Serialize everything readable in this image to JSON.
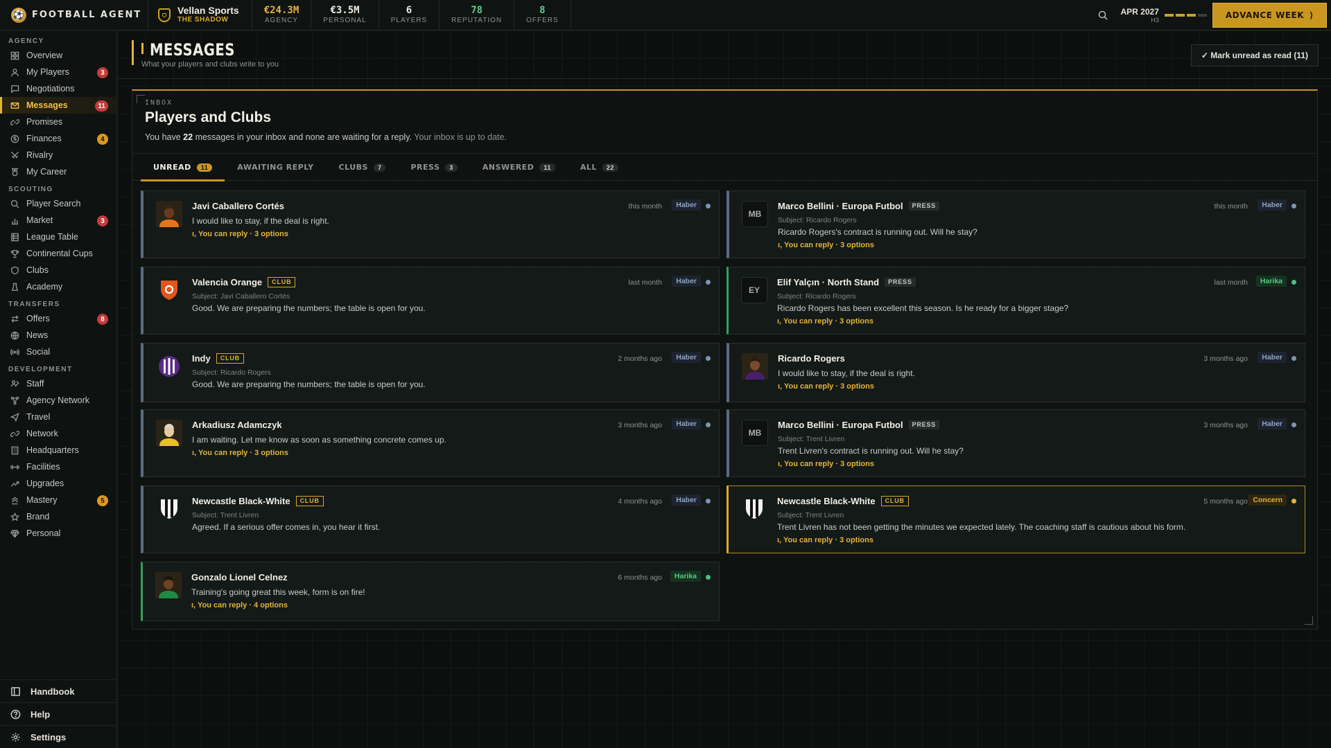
{
  "app": {
    "name": "FOOTBALL AGENT"
  },
  "agency": {
    "name": "Vellan Sports",
    "tagline": "THE SHADOW"
  },
  "stats": [
    {
      "value": "€24.3M",
      "label": "AGENCY"
    },
    {
      "value": "€3.5M",
      "label": "PERSONAL"
    },
    {
      "value": "6",
      "label": "PLAYERS"
    },
    {
      "value": "78",
      "label": "REPUTATION"
    },
    {
      "value": "8",
      "label": "OFFERS"
    }
  ],
  "topbar": {
    "date": "APR 2027",
    "week": "H3",
    "week_progress": 0.75,
    "advance_label": "ADVANCE WEEK"
  },
  "sidebar": {
    "sections": [
      {
        "title": "AGENCY",
        "items": [
          {
            "label": "Overview",
            "icon": "grid-icon"
          },
          {
            "label": "My Players",
            "icon": "user-icon",
            "badge": "3",
            "badge_color": "red"
          },
          {
            "label": "Negotiations",
            "icon": "chat-icon"
          },
          {
            "label": "Messages",
            "icon": "mail-icon",
            "badge": "11",
            "badge_color": "red",
            "active": true
          },
          {
            "label": "Promises",
            "icon": "link-icon"
          },
          {
            "label": "Finances",
            "icon": "coin-icon",
            "badge": "4",
            "badge_color": "amber"
          },
          {
            "label": "Rivalry",
            "icon": "swords-icon"
          },
          {
            "label": "My Career",
            "icon": "medal-icon"
          }
        ]
      },
      {
        "title": "SCOUTING",
        "items": [
          {
            "label": "Player Search",
            "icon": "search-icon"
          },
          {
            "label": "Market",
            "icon": "bars-icon",
            "badge": "3",
            "badge_color": "red"
          },
          {
            "label": "League Table",
            "icon": "table-icon"
          },
          {
            "label": "Continental Cups",
            "icon": "trophy-icon"
          },
          {
            "label": "Clubs",
            "icon": "shield-icon"
          },
          {
            "label": "Academy",
            "icon": "grad-icon"
          }
        ]
      },
      {
        "title": "TRANSFERS",
        "items": [
          {
            "label": "Offers",
            "icon": "swap-icon",
            "badge": "8",
            "badge_color": "red"
          },
          {
            "label": "News",
            "icon": "globe-icon"
          },
          {
            "label": "Social",
            "icon": "radio-icon"
          }
        ]
      },
      {
        "title": "DEVELOPMENT",
        "items": [
          {
            "label": "Staff",
            "icon": "staff-icon"
          },
          {
            "label": "Agency Network",
            "icon": "network-icon"
          },
          {
            "label": "Travel",
            "icon": "plane-icon"
          },
          {
            "label": "Network",
            "icon": "link-icon"
          },
          {
            "label": "Headquarters",
            "icon": "building-icon"
          },
          {
            "label": "Facilities",
            "icon": "dumbbell-icon"
          },
          {
            "label": "Upgrades",
            "icon": "trend-icon"
          },
          {
            "label": "Mastery",
            "icon": "chevrons-icon",
            "badge": "5",
            "badge_color": "amber"
          },
          {
            "label": "Brand",
            "icon": "star-icon"
          },
          {
            "label": "Personal",
            "icon": "gem-icon"
          }
        ]
      }
    ],
    "bottom": [
      {
        "label": "Handbook",
        "icon": "book-icon"
      },
      {
        "label": "Help",
        "icon": "help-icon"
      },
      {
        "label": "Settings",
        "icon": "gear-icon"
      }
    ]
  },
  "page": {
    "title": "MESSAGES",
    "subtitle": "What your players and clubs write to you",
    "mark_read_label": "✓ Mark unread as read (11)"
  },
  "inbox": {
    "eyebrow": "INBOX",
    "title": "Players and Clubs",
    "summary_pre": "You have",
    "summary_count": "22",
    "summary_post": "messages in your inbox and none are waiting for a reply.",
    "summary_status": "Your inbox is up to date.",
    "tabs": [
      {
        "label": "UNREAD",
        "count": "11",
        "active": true
      },
      {
        "label": "AWAITING REPLY",
        "count": ""
      },
      {
        "label": "CLUBS",
        "count": "7"
      },
      {
        "label": "PRESS",
        "count": "3"
      },
      {
        "label": "ANSWERED",
        "count": "11"
      },
      {
        "label": "ALL",
        "count": "22"
      }
    ]
  },
  "messages": [
    {
      "name": "Javi Caballero Cortés",
      "tag": "",
      "subject": "",
      "text": "I would like to stay, if the deal is right.",
      "reply": "You can reply · 3 options",
      "time": "this month",
      "mood": "Haber",
      "avatar": "player-orange"
    },
    {
      "name": "Marco Bellini · Europa Futbol",
      "tag": "PRESS",
      "subject": "Subject: Ricardo Rogers",
      "text": "Ricardo Rogers's contract is running out. Will he stay?",
      "reply": "You can reply · 3 options",
      "time": "this month",
      "mood": "Haber",
      "avatar": "MB"
    },
    {
      "name": "Valencia Orange",
      "tag": "CLUB",
      "subject": "Subject: Javi Caballero Cortés",
      "text": "Good. We are preparing the numbers; the table is open for you.",
      "reply": "",
      "time": "last month",
      "mood": "Haber",
      "avatar": "club-orange"
    },
    {
      "name": "Elif Yalçın · North Stand",
      "tag": "PRESS",
      "subject": "Subject: Ricardo Rogers",
      "text": "Ricardo Rogers has been excellent this season. Is he ready for a bigger stage?",
      "reply": "You can reply · 3 options",
      "time": "last month",
      "mood": "Harika",
      "avatar": "EY"
    },
    {
      "name": "Indy",
      "tag": "CLUB",
      "subject": "Subject: Ricardo Rogers",
      "text": "Good. We are preparing the numbers; the table is open for you.",
      "reply": "",
      "time": "2 months ago",
      "mood": "Haber",
      "avatar": "club-purple"
    },
    {
      "name": "Ricardo Rogers",
      "tag": "",
      "subject": "",
      "text": "I would like to stay, if the deal is right.",
      "reply": "You can reply · 3 options",
      "time": "3 months ago",
      "mood": "Haber",
      "avatar": "player-purple"
    },
    {
      "name": "Arkadiusz Adamczyk",
      "tag": "",
      "subject": "",
      "text": "I am waiting. Let me know as soon as something concrete comes up.",
      "reply": "You can reply · 3 options",
      "time": "3 months ago",
      "mood": "Haber",
      "avatar": "player-yellow"
    },
    {
      "name": "Marco Bellini · Europa Futbol",
      "tag": "PRESS",
      "subject": "Subject: Trent Livren",
      "text": "Trent Livren's contract is running out. Will he stay?",
      "reply": "You can reply · 3 options",
      "time": "3 months ago",
      "mood": "Haber",
      "avatar": "MB"
    },
    {
      "name": "Newcastle Black-White",
      "tag": "CLUB",
      "subject": "Subject: Trent Livren",
      "text": "Agreed. If a serious offer comes in, you hear it first.",
      "reply": "",
      "time": "4 months ago",
      "mood": "Haber",
      "avatar": "club-bw"
    },
    {
      "name": "Newcastle Black-White",
      "tag": "CLUB",
      "subject": "Subject: Trent Livren",
      "text": "Trent Livren has not been getting the minutes we expected lately. The coaching staff is cautious about his form.",
      "reply": "You can reply · 3 options",
      "time": "5 months ago",
      "mood": "Concern",
      "avatar": "club-bw"
    },
    {
      "name": "Gonzalo Lionel Celnez",
      "tag": "",
      "subject": "",
      "text": "Training's going great this week, form is on fire!",
      "reply": "You can reply · 4 options",
      "time": "6 months ago",
      "mood": "Harika",
      "avatar": "player-green"
    }
  ],
  "colors": {
    "accent": "#c9961f",
    "haber": "#7e94b3",
    "harika": "#4fc078",
    "concern": "#e2b43a"
  }
}
